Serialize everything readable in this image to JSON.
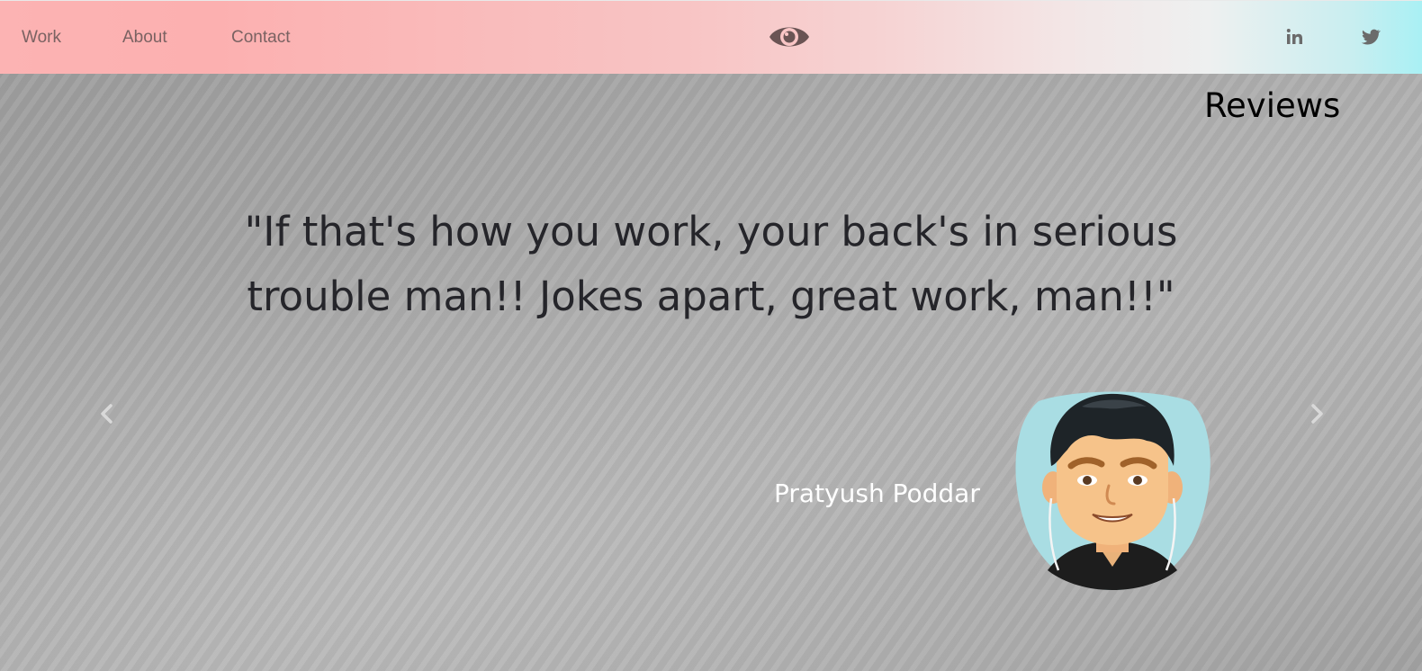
{
  "nav": {
    "links": [
      "Work",
      "About",
      "Contact"
    ],
    "logo_icon": "eye-icon",
    "social": [
      "linkedin-icon",
      "twitter-icon"
    ]
  },
  "reviews": {
    "title": "Reviews",
    "quote": "\"If that's how you work, your back's in serious trouble man!! Jokes apart, great work, man!!\"",
    "reviewer_name": "Pratyush Poddar",
    "prev_icon": "chevron-left-icon",
    "next_icon": "chevron-right-icon"
  },
  "colors": {
    "nav_gradient_start": "#fcb3b3",
    "nav_gradient_end": "#a9f0f4",
    "nav_text": "#7a6262",
    "quote_text": "#25252a",
    "name_text": "#ffffff",
    "avatar_bg": "#a9dde3"
  }
}
